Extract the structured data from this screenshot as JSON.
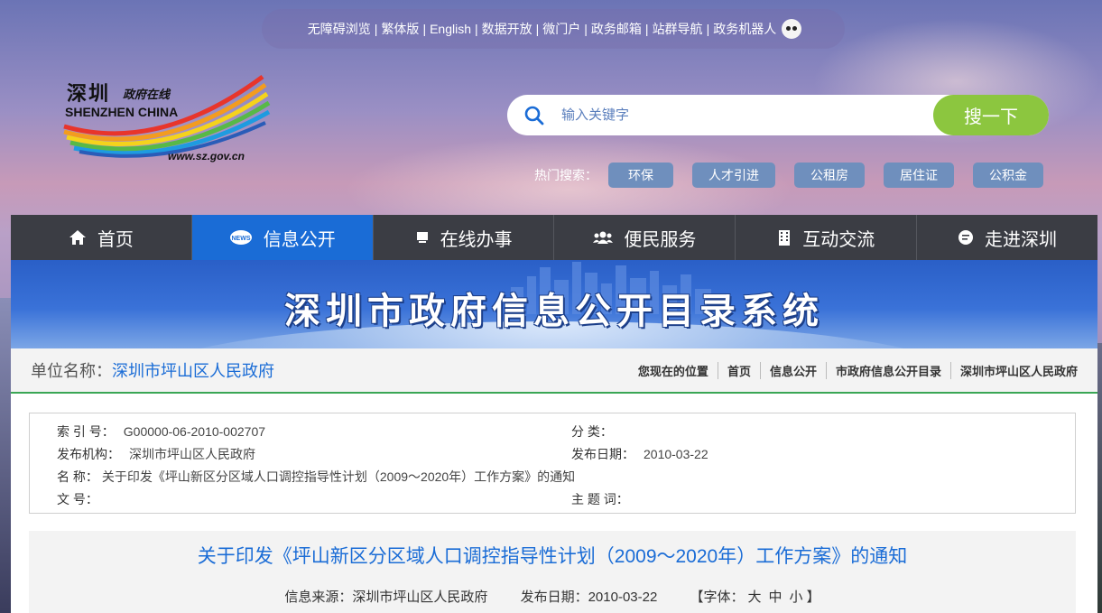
{
  "topbar": {
    "links": [
      "无障碍浏览",
      "繁体版",
      "English",
      "数据开放",
      "微门户",
      "政务邮箱",
      "站群导航",
      "政务机器人"
    ]
  },
  "logo": {
    "cn": "深圳",
    "sub": "政府在线",
    "en": "SHENZHEN CHINA",
    "url": "www.sz.gov.cn"
  },
  "search": {
    "placeholder": "输入关键字",
    "button": "搜一下"
  },
  "hot": {
    "label": "热门搜索：",
    "tags": [
      "环保",
      "人才引进",
      "公租房",
      "居住证",
      "公积金"
    ]
  },
  "nav": {
    "items": [
      {
        "label": "首页",
        "icon": "home-icon"
      },
      {
        "label": "信息公开",
        "icon": "news-icon",
        "active": true
      },
      {
        "label": "在线办事",
        "icon": "monitor-icon"
      },
      {
        "label": "便民服务",
        "icon": "people-icon"
      },
      {
        "label": "互动交流",
        "icon": "building-icon"
      },
      {
        "label": "走进深圳",
        "icon": "chat-icon"
      }
    ]
  },
  "banner": {
    "title": "深圳市政府信息公开目录系统"
  },
  "unit": {
    "label": "单位名称：",
    "name": "深圳市坪山区人民政府"
  },
  "breadcrumb": [
    "您现在的位置",
    "首页",
    "信息公开",
    "市政府信息公开目录",
    "深圳市坪山区人民政府"
  ],
  "meta": {
    "index_label": "索 引 号：",
    "index": "G00000-06-2010-002707",
    "category_label": "分 类：",
    "category": "",
    "publisher_label": "发布机构：",
    "publisher": "深圳市坪山区人民政府",
    "date_label": "发布日期：",
    "date": "2010-03-22",
    "name_label": "名 称：",
    "name": "关于印发《坪山新区分区域人口调控指导性计划（2009～2020年）工作方案》的通知",
    "docno_label": "文 号：",
    "docno": "",
    "subject_label": "主 题 词：",
    "subject": ""
  },
  "doc": {
    "title": "关于印发《坪山新区分区域人口调控指导性计划（2009～2020年）工作方案》的通知",
    "source": "信息来源：深圳市坪山区人民政府",
    "date": "发布日期：2010-03-22",
    "font_label": "【字体：",
    "font_large": "大",
    "font_medium": "中",
    "font_small": "小",
    "font_close": "】"
  },
  "colors": {
    "nav_active": "#1a6cd6",
    "search_button": "#8cc63f",
    "link": "#1a6cd6",
    "divider": "#3aa655"
  }
}
